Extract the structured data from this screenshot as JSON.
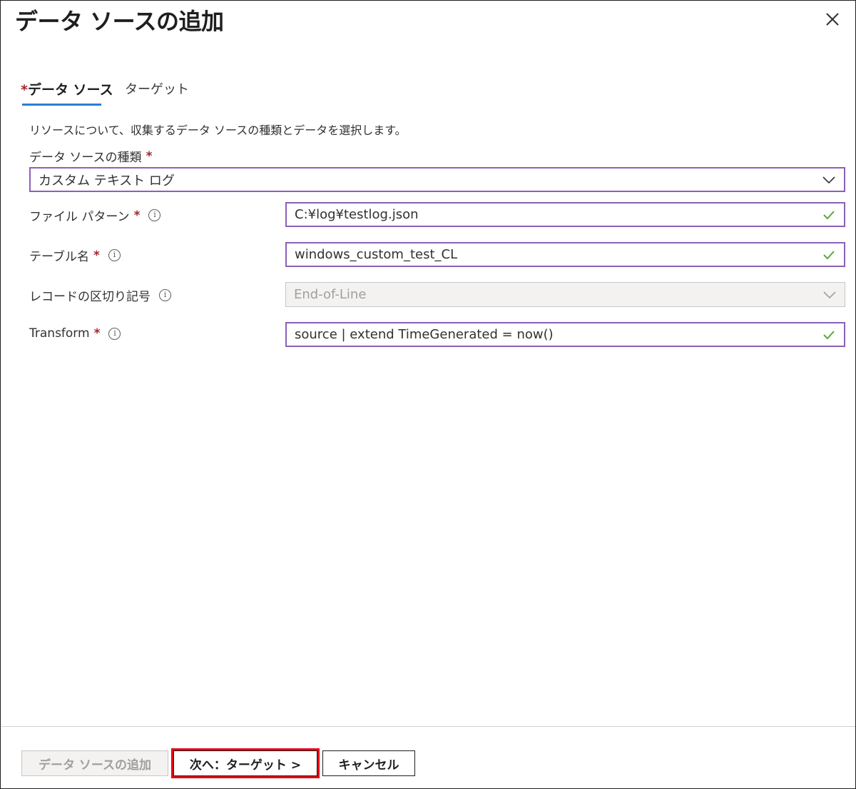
{
  "dialog": {
    "title": "データ ソースの追加"
  },
  "tabs": [
    {
      "required_mark": "*",
      "label": "データ ソース",
      "active": true
    },
    {
      "label": "ターゲット",
      "active": false
    }
  ],
  "description": "リソースについて、収集するデータ ソースの種類とデータを選択します。",
  "form": {
    "data_source_type": {
      "label": "データ ソースの種類",
      "required_mark": "*",
      "value": "カスタム テキスト ログ"
    },
    "file_pattern": {
      "label": "ファイル パターン",
      "required_mark": "*",
      "value": "C:¥log¥testlog.json"
    },
    "table_name": {
      "label": "テーブル名",
      "required_mark": "*",
      "value": "windows_custom_test_CL"
    },
    "record_delimiter": {
      "label": "レコードの区切り記号",
      "value": "End-of-Line"
    },
    "transform": {
      "label": "Transform",
      "required_mark": "*",
      "value": "source | extend TimeGenerated = now()"
    }
  },
  "footer": {
    "add_label": "データ ソースの追加",
    "next_label": "次へ：ターゲット >",
    "cancel_label": "キャンセル"
  },
  "colors": {
    "accent_border": "#8a61b8",
    "tab_underline": "#2f7bd3",
    "required": "#a4262c",
    "valid_check": "#5aa83a",
    "highlight_box": "#e60012"
  },
  "icons": {
    "close": "close-icon",
    "info": "info-icon",
    "dropdown": "chevron-down-icon",
    "valid": "checkmark-icon"
  }
}
